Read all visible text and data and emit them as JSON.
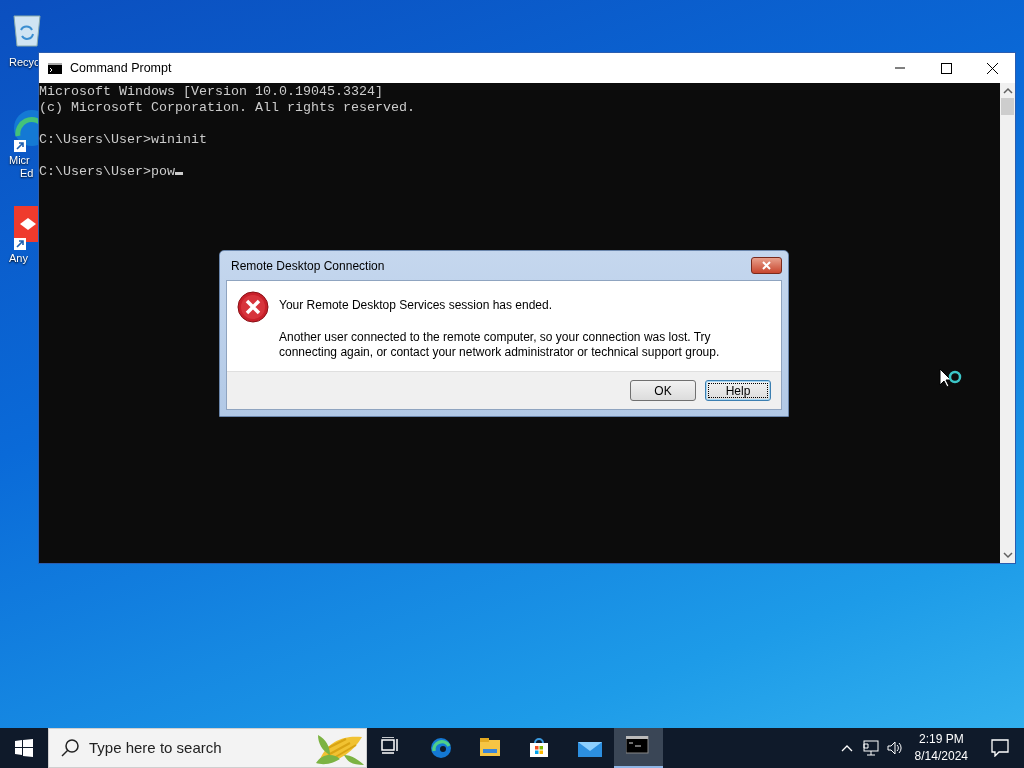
{
  "desktop": {
    "icons": [
      {
        "kind": "recycle-bin",
        "label_lines": [
          "Recyc"
        ]
      },
      {
        "kind": "edge",
        "label_lines": [
          "Micr",
          "Ed"
        ]
      },
      {
        "kind": "app",
        "label_lines": [
          "Any"
        ]
      }
    ]
  },
  "console_window": {
    "title": "Command Prompt",
    "blocks": [
      [
        "Microsoft Windows [Version 10.0.19045.3324]",
        "(c) Microsoft Corporation. All rights reserved."
      ],
      [
        "C:\\Users\\User>wininit"
      ],
      [
        "C:\\Users\\User>pow"
      ]
    ],
    "cursor": true
  },
  "dialog": {
    "title": "Remote Desktop Connection",
    "heading": "Your Remote Desktop Services session has ended.",
    "message": "Another user connected to the remote computer, so your connection was lost. Try connecting again, or contact your network administrator or technical support group.",
    "buttons": [
      {
        "label": "OK",
        "focused": false
      },
      {
        "label": "Help",
        "focused": true
      }
    ]
  },
  "taskbar": {
    "search": {
      "placeholder": "Type here to search"
    },
    "apps": [
      {
        "kind": "task-view",
        "active": false
      },
      {
        "kind": "edge",
        "active": false
      },
      {
        "kind": "explorer",
        "active": false
      },
      {
        "kind": "store",
        "active": false
      },
      {
        "kind": "mail",
        "active": false
      },
      {
        "kind": "console",
        "active": true
      }
    ],
    "time": "2:19 PM",
    "date": "8/14/2024"
  }
}
